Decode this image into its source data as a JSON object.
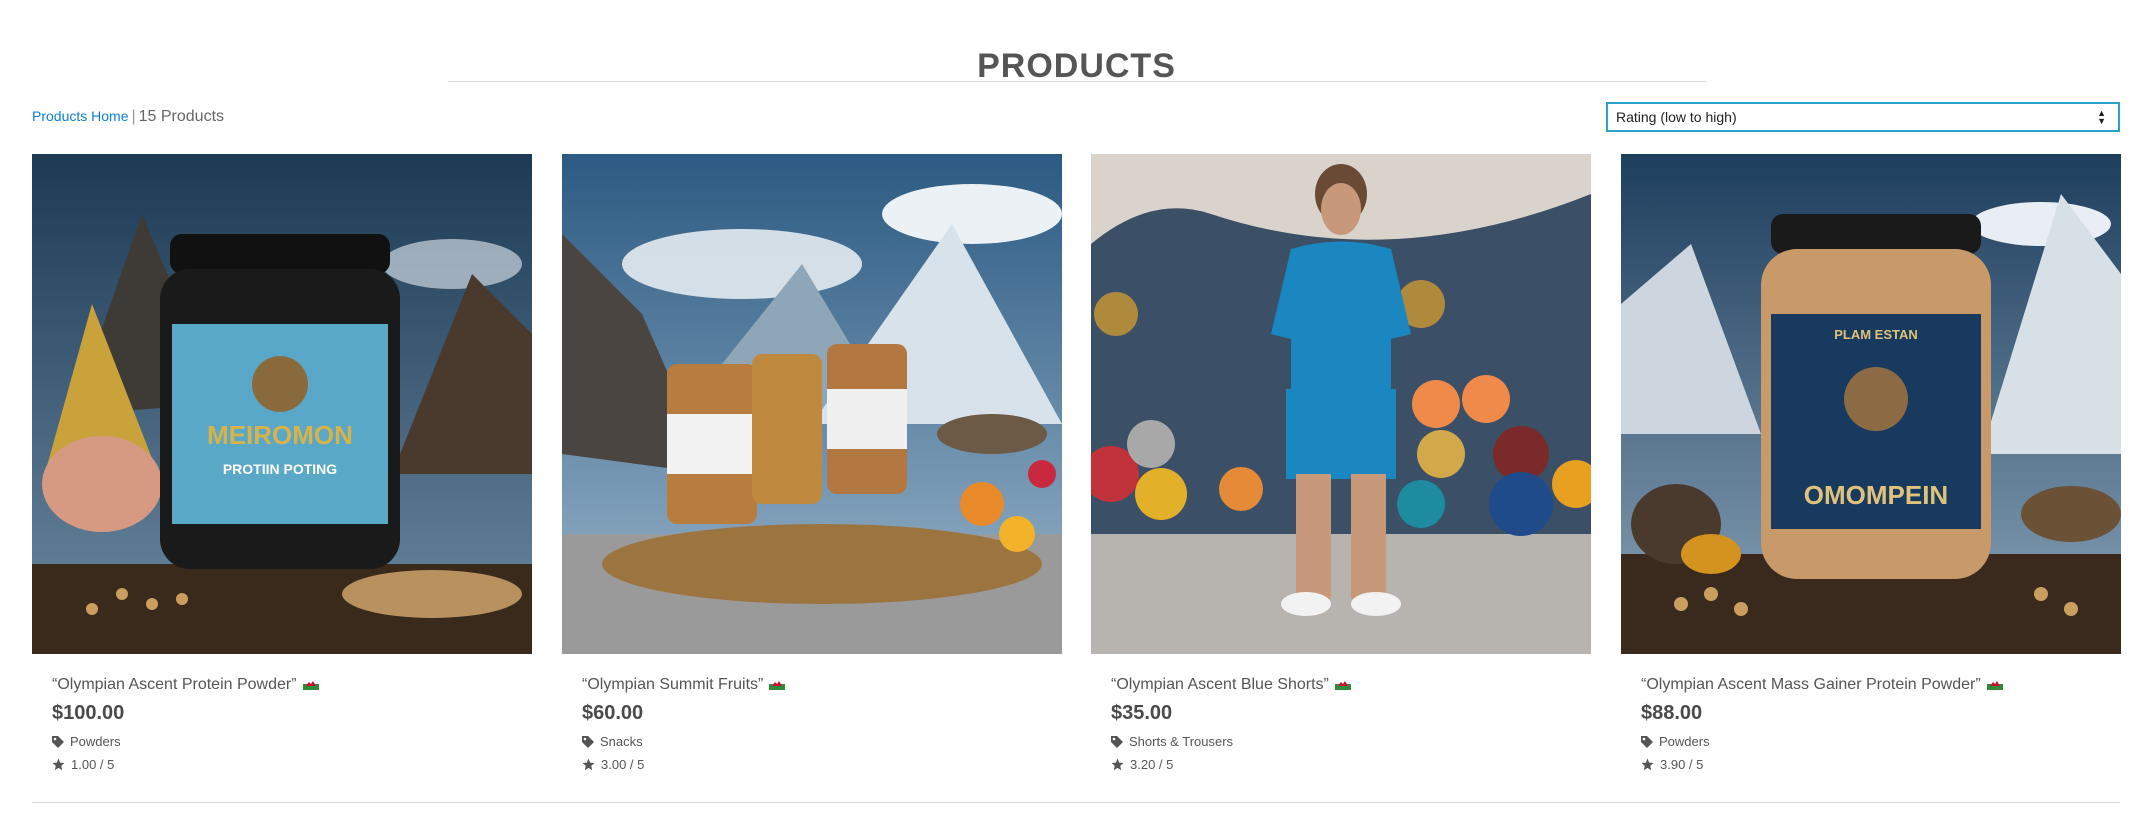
{
  "page": {
    "title": "PRODUCTS"
  },
  "breadcrumb": {
    "home_label": "Products Home",
    "separator": "|",
    "count_label": "15 Products"
  },
  "sort": {
    "selected": "Rating (low to high)"
  },
  "products": [
    {
      "name": "“Olympian Ascent Protein Powder”",
      "price": "$100.00",
      "category": "Powders",
      "rating": "1.00 / 5",
      "image": "protein-powder-jar-scene"
    },
    {
      "name": "“Olympian Summit Fruits”",
      "price": "$60.00",
      "category": "Snacks",
      "rating": "3.00 / 5",
      "image": "nut-jars-mountain-scene"
    },
    {
      "name": "“Olympian Ascent Blue Shorts”",
      "price": "$35.00",
      "category": "Shorts & Trousers",
      "rating": "3.20 / 5",
      "image": "man-in-blue-outfit-gym-scene"
    },
    {
      "name": "“Olympian Ascent Mass Gainer Protein Powder”",
      "price": "$88.00",
      "category": "Powders",
      "rating": "3.90 / 5",
      "image": "mass-gainer-jar-scene"
    }
  ],
  "icons": {
    "category": "tag-icon",
    "rating": "star-icon",
    "flag": "flag-icon"
  }
}
